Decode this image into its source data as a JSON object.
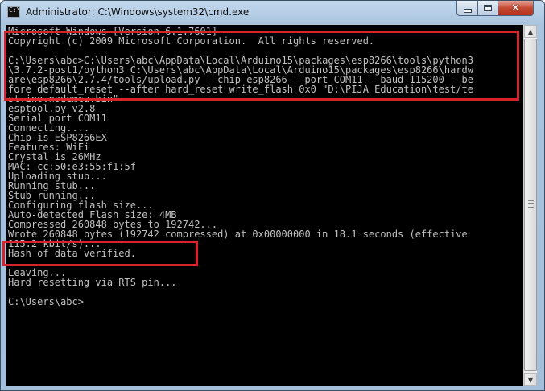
{
  "window": {
    "title": "Administrator: C:\\Windows\\system32\\cmd.exe",
    "app_icon": "cmd-icon",
    "controls": {
      "minimize_icon": "minimize-icon",
      "maximize_icon": "maximize-icon",
      "close_icon": "close-icon"
    }
  },
  "console": {
    "lines": [
      "Microsoft Windows [Version 6.1.7601]",
      "Copyright (c) 2009 Microsoft Corporation.  All rights reserved.",
      "",
      "C:\\Users\\abc>C:\\Users\\abc\\AppData\\Local\\Arduino15\\packages\\esp8266\\tools\\python3",
      "\\3.7.2-post1/python3 C:\\Users\\abc\\AppData\\Local\\Arduino15\\packages\\esp8266\\hardw",
      "are\\esp8266\\2.7.4/tools/upload.py --chip esp8266 --port COM11 --baud 115200 --be",
      "fore default_reset --after hard_reset write_flash 0x0 \"D:\\PIJA Education\\test/te",
      "st.ino.nodemcu.bin\"",
      "esptool.py v2.8",
      "Serial port COM11",
      "Connecting....",
      "Chip is ESP8266EX",
      "Features: WiFi",
      "Crystal is 26MHz",
      "MAC: cc:50:e3:55:f1:5f",
      "Uploading stub...",
      "Running stub...",
      "Stub running...",
      "Configuring flash size...",
      "Auto-detected Flash size: 4MB",
      "Compressed 260848 bytes to 192742...",
      "Wrote 260848 bytes (192742 compressed) at 0x00000000 in 18.1 seconds (effective",
      "115.2 kbit/s)...",
      "Hash of data verified.",
      "",
      "Leaving...",
      "Hard resetting via RTS pin...",
      "",
      "C:\\Users\\abc>"
    ]
  },
  "colors": {
    "console_bg": "#000000",
    "console_text": "#c0c0c0",
    "highlight": "#d8232a"
  },
  "scrollbar": {
    "up_icon": "scroll-up-arrow-icon",
    "down_icon": "scroll-down-arrow-icon",
    "position": 0.0
  }
}
